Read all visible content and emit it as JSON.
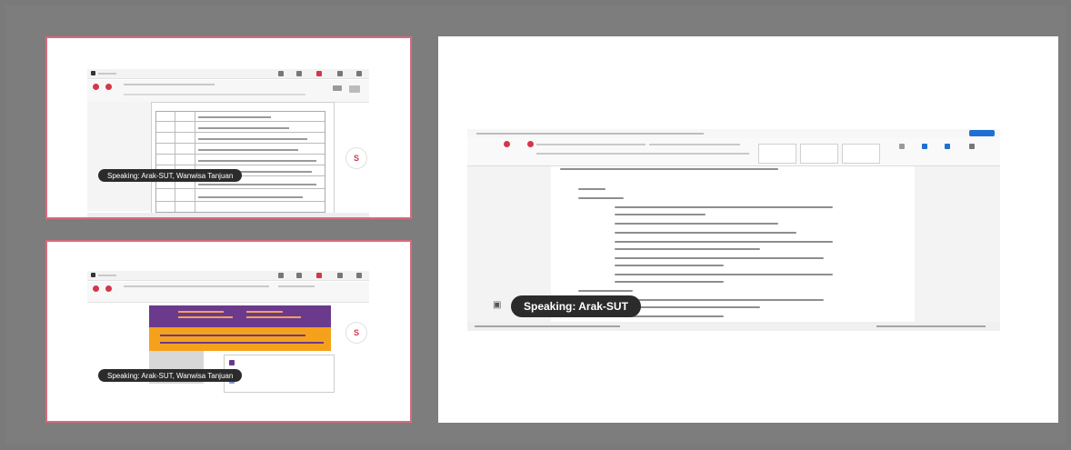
{
  "participants": {
    "top_left": {
      "speaking_label": "Speaking: Arak-SUT, Wanwisa Tanjuan"
    },
    "bottom_left": {
      "speaking_label": "Speaking: Arak-SUT, Wanwisa Tanjuan"
    },
    "main": {
      "speaking_label": "Speaking: Arak-SUT"
    }
  },
  "colors": {
    "background": "#7d7d7d",
    "tile_border": "#d66b7e",
    "pill_bg": "#2b2b2b",
    "record_red": "#d2374b",
    "sheet_purple": "#6b3a8c",
    "sheet_orange": "#f5a11b",
    "word_accent": "#1f6fd1"
  },
  "icons": {
    "record": "record-dot-icon",
    "share_screen": "share-screen-icon"
  }
}
